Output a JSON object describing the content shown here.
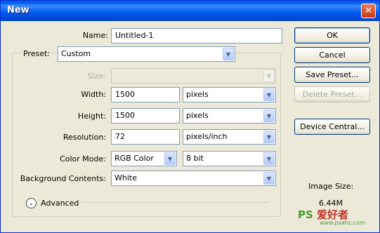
{
  "window": {
    "title": "New",
    "close": "✕"
  },
  "name": {
    "label": "Name:",
    "value": "Untitled-1"
  },
  "preset": {
    "label": "Preset:",
    "value": "Custom"
  },
  "size": {
    "label": "Size:",
    "value": ""
  },
  "width": {
    "label": "Width:",
    "value": "1500",
    "unit": "pixels"
  },
  "height": {
    "label": "Height:",
    "value": "1500",
    "unit": "pixels"
  },
  "resolution": {
    "label": "Resolution:",
    "value": "72",
    "unit": "pixels/inch"
  },
  "color_mode": {
    "label": "Color Mode:",
    "value": "RGB Color",
    "depth": "8 bit"
  },
  "background": {
    "label": "Background Contents:",
    "value": "White"
  },
  "advanced": {
    "label": "Advanced"
  },
  "buttons": {
    "ok": "OK",
    "cancel": "Cancel",
    "save_preset": "Save Preset...",
    "delete_preset": "Delete Preset...",
    "device_central": "Device Central..."
  },
  "image_size": {
    "label": "Image Size:",
    "value": "6.44M"
  },
  "watermark": {
    "brand": "PS",
    "chars": "爱好者",
    "url": "www.psahz.com"
  },
  "icons": {
    "dropdown": "chevron-down-icon",
    "advanced_toggle": "expand-icon",
    "close": "close-icon"
  },
  "colors": {
    "title_bar": "#0058ee",
    "dialog_bg": "#ece9d8",
    "close_button": "#c8390f"
  }
}
